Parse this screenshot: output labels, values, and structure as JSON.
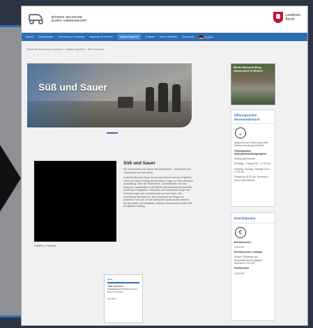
{
  "header": {
    "logo_line1": "BÖRDE-MUSEUM",
    "logo_line2": "BURG UMMENDORF",
    "region_line1": "Landkreis",
    "region_line2": "Börde"
  },
  "nav": {
    "items": [
      "Aktuell",
      "Ausstellungen",
      "Sammlung & Forschung",
      "Angebote für Schulen",
      "Digitale Angebote",
      "Projekte",
      "Unser Netzwerk",
      "Downloads"
    ],
    "active_index": 4,
    "language": "Deutsch"
  },
  "breadcrumb": "Börde-Museum Burg Ummendorf  >  Digitale Angebote  >  Süß und Sauer",
  "hero": {
    "title": "Süß und Sauer"
  },
  "video": {
    "caption": "Lifestile | c. Zeppelin"
  },
  "article": {
    "title": "Süß und Sauer",
    "subtitle": "Wo Zuckerrüben und Säure nah beieinander – Schicksale und Geschichten aus der Börde.",
    "body": "Im Börde-Museum Burg Ummendorf können seit den Projekten »Süß und Sauer« häufig die Besucher Fragen zu einer virtuellen Ausstellung. Über die Rübenernte, Zuckerfabriken und den Alltag der Landarbeiter in der Börde wird eindrucksvoll berichtet. Zahlreiche Fotografien, Interviews und Dokumente zeigen die Veränderungen der Landwirtschaft und der Dörfer. Die Ausstellung lädt dazu ein, die Geschichte der Region zu entdecken und sich mit den Menschen auseinanderzusetzen, die hier lebten und arbeiteten. Weitere Informationen finden Sie im digitalen Katalog."
  },
  "document": {
    "brand": "gvbd",
    "title": "\"Süß und Sauer\"",
    "subtitle": "Digitalkatalog für Börde-Museum Burg Ummendorf",
    "date": "Juli 2021"
  },
  "sidebar": {
    "image_title": "Börde-Museum Burg Ummendorf in Bildern",
    "hours": {
      "heading": "Öffnungszeiten Museumsbesuch",
      "note": "Aufgrund einer Sanierung ist das Museum derzeit geschlossen.",
      "sub_heading": "Öffnungszeiten Außengelände/Anlagengarten",
      "line1": "Montag geschlossen",
      "line2": "Dienstag – Freitag 9.00 – 17.00 Uhr",
      "line3": "Samstag, Sonntag, Feiertag 11.00 – 17.00 Uhr",
      "line4": "Einlass bis 16.30 Uhr. Dezember – Januar geschlossen."
    },
    "fees": {
      "heading": "Eintrittspreise",
      "line1_label": "Einzelbesucher",
      "line1_value": "3,00 EUR",
      "line2_label": "Einzelbesucher, ermäßigt",
      "line2_value": "Schüler, Studenten und Auszubildende mit gültigem Nachweis 2,00 EUR",
      "line3_label": "Familienkarte",
      "line3_value": "6,00 EUR"
    }
  }
}
